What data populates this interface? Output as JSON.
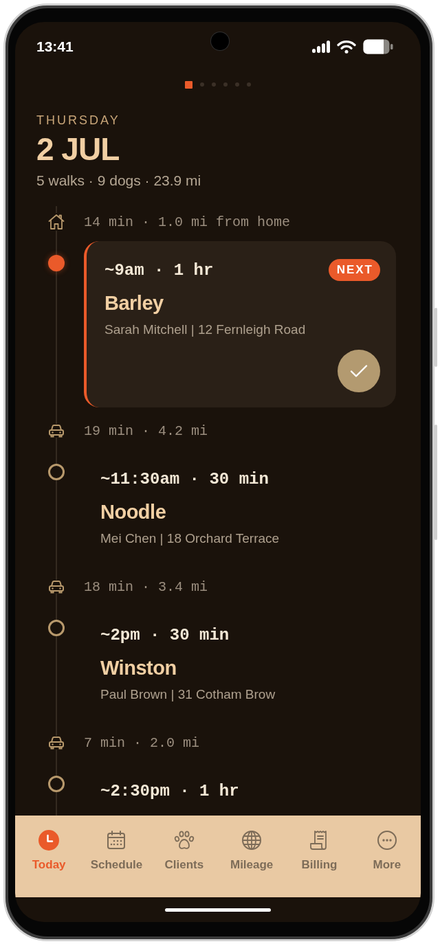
{
  "status_bar": {
    "time": "13:41"
  },
  "page_indicator": [
    {
      "selected": true
    },
    {
      "selected": false
    },
    {
      "selected": false
    },
    {
      "selected": false
    },
    {
      "selected": false
    },
    {
      "selected": false
    }
  ],
  "header": {
    "weekday": "THURSDAY",
    "date": "2 JUL",
    "summary": "5 walks · 9 dogs · 23.9 mi"
  },
  "timeline": [
    {
      "kind": "home",
      "text": "14 min · 1.0 mi from home"
    },
    {
      "kind": "walk",
      "next": true,
      "badge": "NEXT",
      "time": "~9am · 1 hr",
      "dog": "Barley",
      "details": "Sarah Mitchell | 12 Fernleigh Road"
    },
    {
      "kind": "drive",
      "text": "19 min · 4.2 mi"
    },
    {
      "kind": "walk",
      "next": false,
      "time": "~11:30am · 30 min",
      "dog": "Noodle",
      "details": "Mei Chen | 18 Orchard Terrace"
    },
    {
      "kind": "drive",
      "text": "18 min · 3.4 mi"
    },
    {
      "kind": "walk",
      "next": false,
      "time": "~2pm · 30 min",
      "dog": "Winston",
      "details": "Paul Brown | 31 Cotham Brow"
    },
    {
      "kind": "drive",
      "text": "7 min · 2.0 mi"
    },
    {
      "kind": "walk",
      "next": false,
      "time": "~2:30pm · 1 hr"
    }
  ],
  "nav": [
    {
      "label": "Today",
      "selected": true
    },
    {
      "label": "Schedule",
      "selected": false
    },
    {
      "label": "Clients",
      "selected": false
    },
    {
      "label": "Mileage",
      "selected": false
    },
    {
      "label": "Billing",
      "selected": false
    },
    {
      "label": "More",
      "selected": false
    }
  ]
}
